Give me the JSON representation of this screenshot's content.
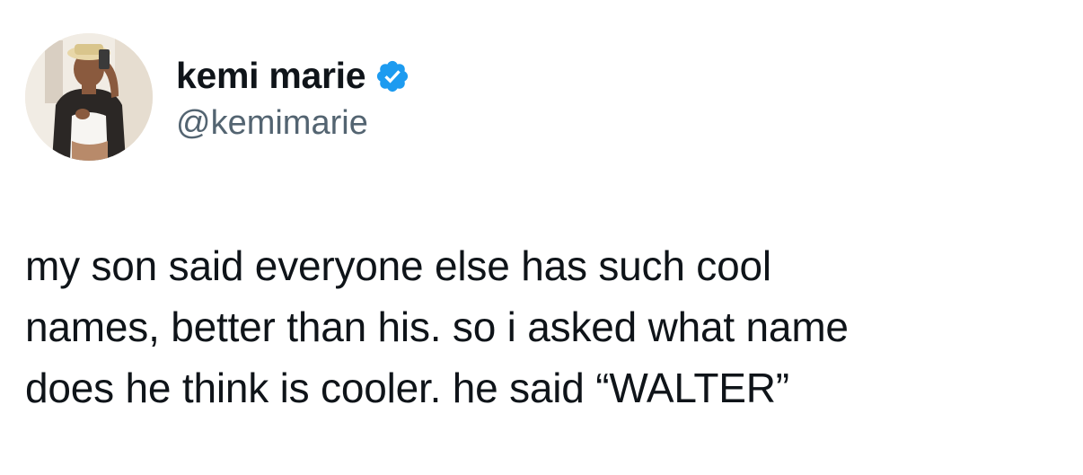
{
  "author": {
    "display_name": "kemi marie",
    "handle": "@kemimarie",
    "verified": true,
    "verified_color": "#1d9bf0",
    "avatar_icon": "profile-photo"
  },
  "tweet": {
    "lines": [
      "my son said everyone else has such cool",
      "names, better than his. so i asked what name",
      "does he think is cooler. he said “WALTER”"
    ]
  }
}
